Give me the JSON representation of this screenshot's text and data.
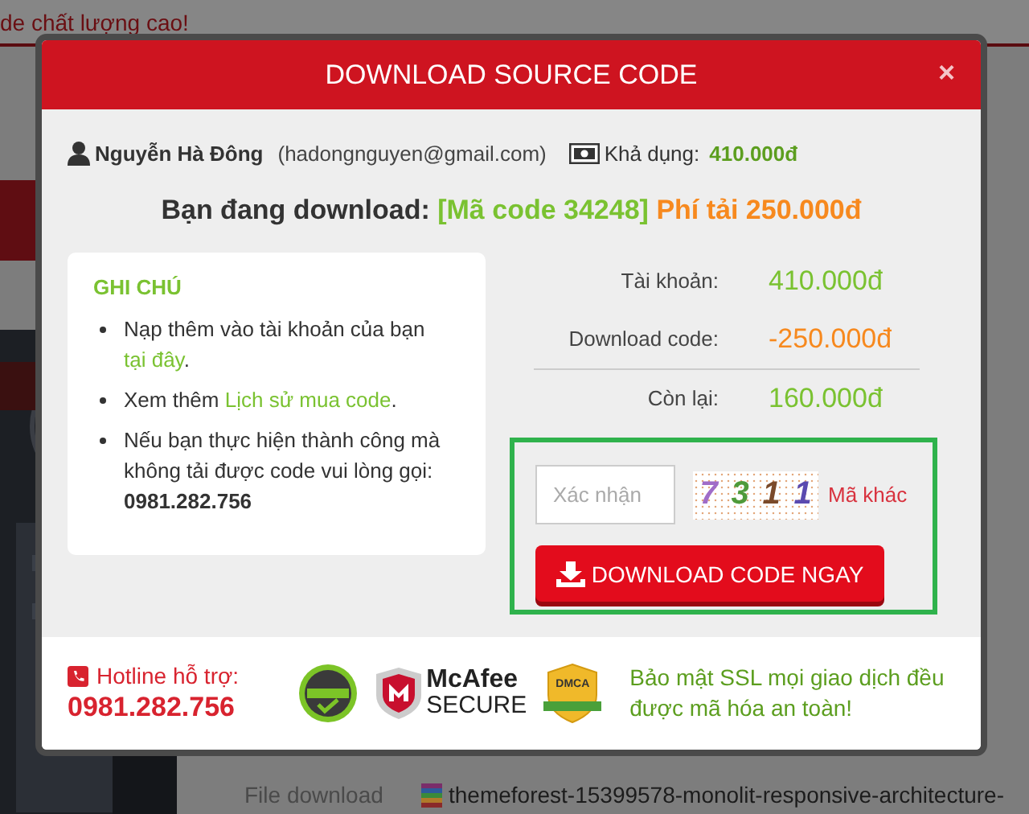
{
  "background_page": {
    "tagline": "de chất lượng cao!",
    "file_label": "File download",
    "file_name": "themeforest-15399578-monolit-responsive-architecture-"
  },
  "modal": {
    "title": "DOWNLOAD SOURCE CODE",
    "close": "×",
    "user": {
      "name": "Nguyễn Hà Đông",
      "email": "(hadongnguyen@gmail.com)",
      "balance_label": "Khả dụng:",
      "balance": "410.000đ"
    },
    "download_line": {
      "label": "Bạn đang download:",
      "code": "[Mã code 34248]",
      "fee": "Phí tải 250.000đ"
    },
    "notes": {
      "title": "GHI CHÚ",
      "items": [
        {
          "kind": "link",
          "before": "Nạp thêm vào tài khoản của bạn ",
          "link": "tại đây",
          "after": "."
        },
        {
          "kind": "link",
          "before": "Xem thêm ",
          "link": "Lịch sử mua code",
          "after": "."
        },
        {
          "kind": "text",
          "text": "Nếu bạn thực hiện thành công mà không tải được code vui lòng gọi: **0981.282.756**"
        }
      ]
    },
    "summary": [
      {
        "label": "Tài khoản:",
        "value": "410.000đ",
        "color": "#7ac231"
      },
      {
        "label": "Download code:",
        "value": "-250.000đ",
        "color": "#f7891e"
      },
      {
        "label": "Còn lại:",
        "value": "160.000đ",
        "color": "#7ac231"
      }
    ],
    "confirm": {
      "placeholder": "Xác nhận",
      "captcha": [
        {
          "char": "7",
          "color": "#a06cc8"
        },
        {
          "char": "3",
          "color": "#4f9a3a"
        },
        {
          "char": "1",
          "color": "#7a4a2a"
        },
        {
          "char": "1",
          "color": "#5a4ab0"
        }
      ],
      "refresh": "Mã khác",
      "button": "DOWNLOAD CODE NGAY"
    },
    "footer": {
      "hotline_label": "Hotline hỗ trợ:",
      "hotline": "0981.282.756",
      "mcafee": "McAfee",
      "secure": "SECURE",
      "dmca": "DMCA",
      "ssl_note": "Bảo mật SSL mọi giao dịch đều được mã hóa an toàn!"
    }
  }
}
